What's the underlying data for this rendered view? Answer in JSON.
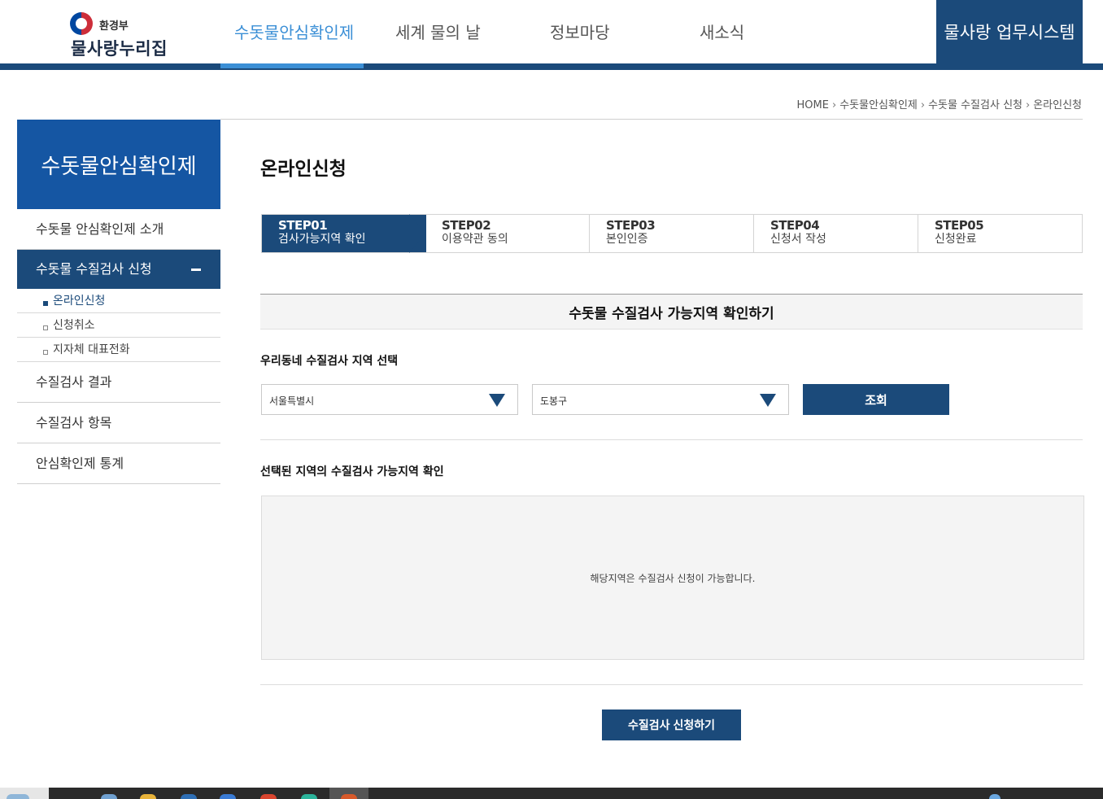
{
  "header": {
    "ministry": "환경부",
    "site_name": "물사랑누리집",
    "nav": [
      "수돗물안심확인제",
      "세계 물의 날",
      "정보마당",
      "새소식"
    ],
    "business_system": "물사랑 업무시스템"
  },
  "breadcrumb": [
    "HOME",
    "수돗물안심확인제",
    "수돗물 수질검사 신청",
    "온라인신청"
  ],
  "sidebar": {
    "title": "수돗물안심확인제",
    "items": [
      {
        "label": "수돗물 안심확인제 소개"
      },
      {
        "label": "수돗물 수질검사 신청"
      },
      {
        "label": "수질검사 결과"
      },
      {
        "label": "수질검사 항목"
      },
      {
        "label": "안심확인제 통계"
      }
    ],
    "sub_items": [
      "온라인신청",
      "신청취소",
      "지자체 대표전화"
    ]
  },
  "main": {
    "title": "온라인신청",
    "steps": [
      {
        "no": "STEP01",
        "name": "검사가능지역 확인"
      },
      {
        "no": "STEP02",
        "name": "이용약관 동의"
      },
      {
        "no": "STEP03",
        "name": "본인인증"
      },
      {
        "no": "STEP04",
        "name": "신청서 작성"
      },
      {
        "no": "STEP05",
        "name": "신청완료"
      }
    ],
    "current_step": 1,
    "section_title": "수돗물 수질검사 가능지역 확인하기",
    "region_label": "우리동네 수질검사 지역 선택",
    "city_select": "서울특별시",
    "district_select": "도봉구",
    "search_button": "조회",
    "result_label": "선택된 지역의 수질검사 가능지역 확인",
    "result_message": "해당지역은 수질검사 신청이 가능합니다.",
    "apply_button": "수질검사 신청하기"
  },
  "colors": {
    "primary": "#1b4a7a",
    "side_title": "#1556a3",
    "nav_active": "#3b8fd6"
  }
}
